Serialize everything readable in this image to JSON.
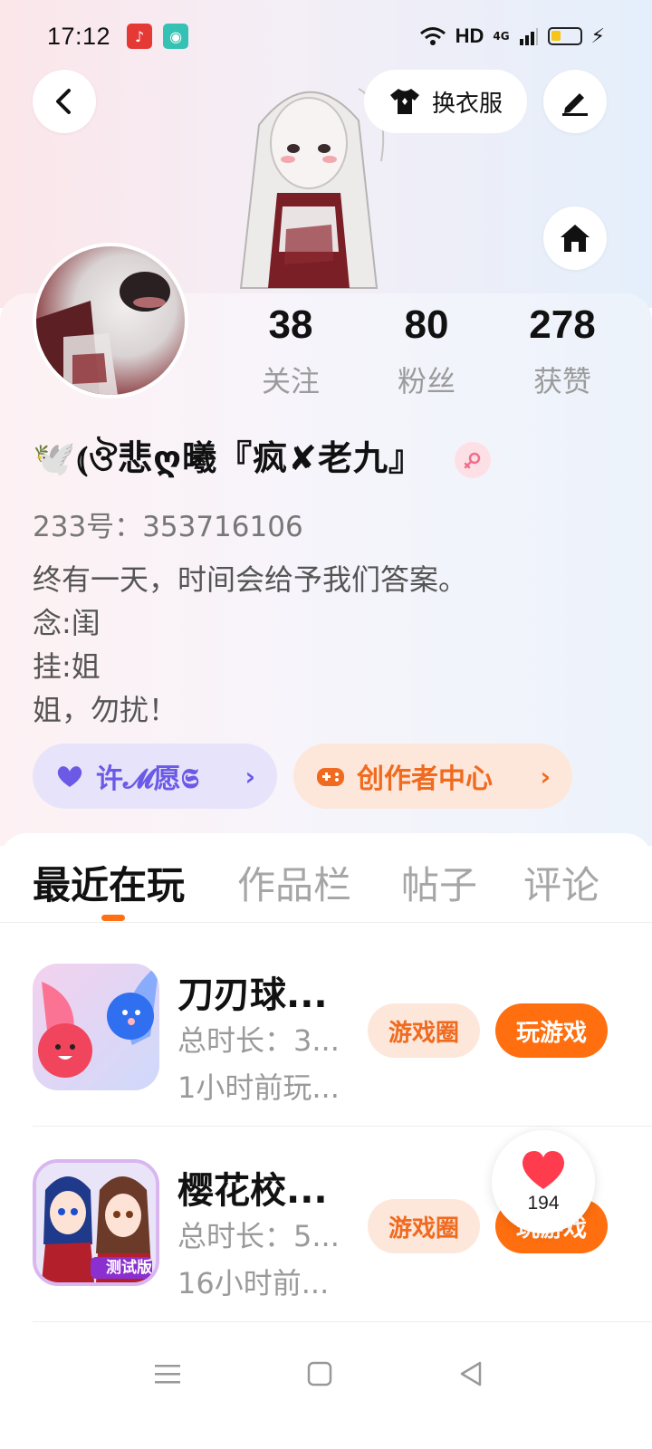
{
  "status_bar": {
    "time": "17:12",
    "network": "HD",
    "signal": "4G",
    "battery_level": 0.35,
    "app_icons": [
      "music-icon",
      "phone-clean-icon"
    ]
  },
  "header": {
    "back_icon": "chevron-left-icon",
    "outfit_button_label": "换衣服",
    "edit_icon": "pen-icon",
    "home_icon": "home-icon"
  },
  "profile": {
    "stats": [
      {
        "value": "38",
        "label": "关注"
      },
      {
        "value": "80",
        "label": "粉丝"
      },
      {
        "value": "278",
        "label": "获赞"
      }
    ],
    "nickname": "🕊️⦅ঔ悲ღ曦『疯✘老九』",
    "gender": "female",
    "uid": "233号：353716106",
    "bio_lines": [
      "终有一天，时间会给予我们答案。",
      "念:闺",
      "挂:姐",
      "姐，勿扰！"
    ],
    "wish_button_label": "许𝓜愿𝕾",
    "creator_button_label": "创作者中心"
  },
  "tabs": [
    {
      "label": "最近在玩",
      "active": true
    },
    {
      "label": "作品栏",
      "active": false
    },
    {
      "label": "帖子",
      "active": false
    },
    {
      "label": "评论",
      "active": false
    }
  ],
  "games": [
    {
      "name": "刀刃球...",
      "duration": "总时长：3...",
      "last_played": "1小时前玩...",
      "circle_label": "游戏圈",
      "play_label": "玩游戏"
    },
    {
      "name": "樱花校...",
      "duration": "总时长：5...",
      "last_played": "16小时前...",
      "circle_label": "游戏圈",
      "play_label": "玩游戏",
      "icon_badge": "测试版"
    }
  ],
  "floating_like": {
    "count": "194"
  },
  "colors": {
    "accent": "#ff6f0f",
    "wish": "#6a5ae6",
    "like": "#ff3b4e"
  }
}
